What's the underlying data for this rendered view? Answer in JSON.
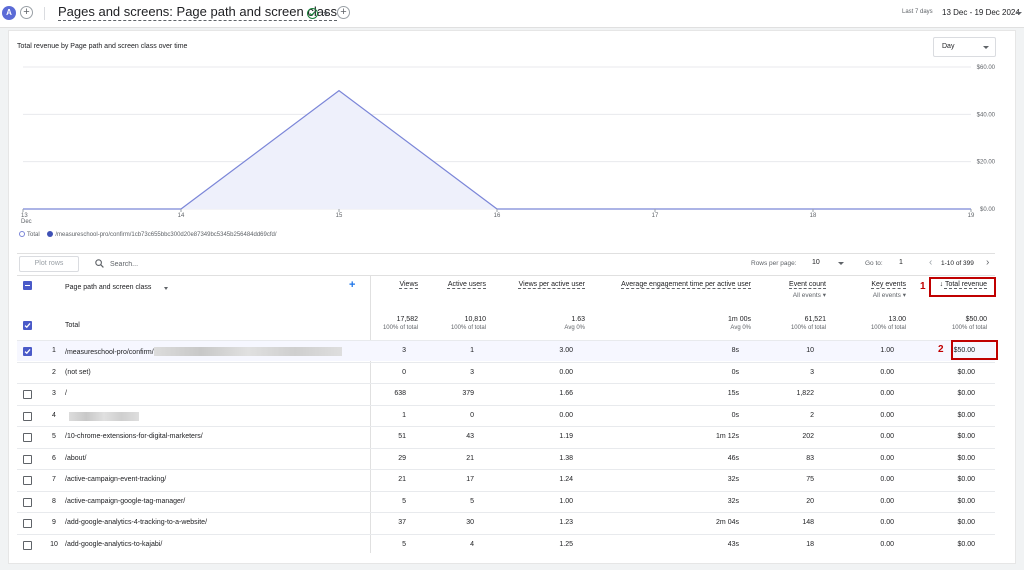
{
  "header": {
    "avatar_letter": "A",
    "title": "Pages and screens: Page path and screen class",
    "date_label": "Last 7 days",
    "date_range": "13 Dec - 19 Dec 2024"
  },
  "chart_card": {
    "title": "Total revenue by Page path and screen class over time",
    "granularity": "Day"
  },
  "chart_data": {
    "type": "area",
    "x": [
      "13 Dec",
      "14",
      "15",
      "16",
      "17",
      "18",
      "19"
    ],
    "x_ticks": [
      {
        "line1": "13",
        "line2": "Dec"
      },
      {
        "line1": "14",
        "line2": ""
      },
      {
        "line1": "15",
        "line2": ""
      },
      {
        "line1": "16",
        "line2": ""
      },
      {
        "line1": "17",
        "line2": ""
      },
      {
        "line1": "18",
        "line2": ""
      },
      {
        "line1": "19",
        "line2": ""
      }
    ],
    "y_ticks": [
      "$0.00",
      "$20.00",
      "$40.00",
      "$60.00"
    ],
    "ylim": [
      0,
      60
    ],
    "series": [
      {
        "name": "Total",
        "values": [
          0,
          0,
          50,
          0,
          0,
          0,
          0
        ],
        "color": "#7b86d8"
      },
      {
        "name": "/measureschool-pro/confirm/1cb73c655bbc300d20e87349bc5345b256484dd69cfd/",
        "values": [
          0,
          0,
          50,
          0,
          0,
          0,
          0
        ],
        "color": "#3f51b5"
      }
    ],
    "grid": true,
    "legend_position": "bottom-left"
  },
  "legend": {
    "total": "Total",
    "page": "/measureschool-pro/confirm/1cb73c655bbc300d20e87349bc5345b256484dd69cfd/"
  },
  "toolbar": {
    "plot_rows": "Plot rows",
    "search_placeholder": "Search...",
    "rows_per_page_label": "Rows per page:",
    "rows_per_page": "10",
    "goto_label": "Go to:",
    "goto_value": "1",
    "pager": "1-10 of 399"
  },
  "table": {
    "dimension_header": "Page path and screen class",
    "columns": [
      {
        "label": "Views",
        "sub": ""
      },
      {
        "label": "Active users",
        "sub": ""
      },
      {
        "label": "Views per active user",
        "sub": ""
      },
      {
        "label": "Average engagement time per active user",
        "sub": ""
      },
      {
        "label": "Event count",
        "sub": "All events"
      },
      {
        "label": "Key events",
        "sub": "All events"
      },
      {
        "label": "Total revenue",
        "sub": ""
      }
    ],
    "total": {
      "label": "Total",
      "values": [
        "17,582",
        "10,810",
        "1.63",
        "1m 00s",
        "61,521",
        "13.00",
        "$50.00"
      ],
      "subs": [
        "100% of total",
        "100% of total",
        "Avg 0%",
        "Avg 0%",
        "100% of total",
        "100% of total",
        "100% of total"
      ]
    },
    "rows": [
      {
        "rank": "1",
        "path": "/measureschool-pro/confirm/",
        "values": [
          "3",
          "1",
          "3.00",
          "8s",
          "10",
          "1.00",
          "$50.00"
        ]
      },
      {
        "rank": "2",
        "path": "(not set)",
        "values": [
          "0",
          "3",
          "0.00",
          "0s",
          "3",
          "0.00",
          "$0.00"
        ]
      },
      {
        "rank": "3",
        "path": "/",
        "values": [
          "638",
          "379",
          "1.66",
          "15s",
          "1,822",
          "0.00",
          "$0.00"
        ]
      },
      {
        "rank": "4",
        "path": "",
        "values": [
          "1",
          "0",
          "0.00",
          "0s",
          "2",
          "0.00",
          "$0.00"
        ]
      },
      {
        "rank": "5",
        "path": "/10-chrome-extensions-for-digital-marketers/",
        "values": [
          "51",
          "43",
          "1.19",
          "1m 12s",
          "202",
          "0.00",
          "$0.00"
        ]
      },
      {
        "rank": "6",
        "path": "/about/",
        "values": [
          "29",
          "21",
          "1.38",
          "46s",
          "83",
          "0.00",
          "$0.00"
        ]
      },
      {
        "rank": "7",
        "path": "/active-campaign-event-tracking/",
        "values": [
          "21",
          "17",
          "1.24",
          "32s",
          "75",
          "0.00",
          "$0.00"
        ]
      },
      {
        "rank": "8",
        "path": "/active-campaign-google-tag-manager/",
        "values": [
          "5",
          "5",
          "1.00",
          "32s",
          "20",
          "0.00",
          "$0.00"
        ]
      },
      {
        "rank": "9",
        "path": "/add-google-analytics-4-tracking-to-a-website/",
        "values": [
          "37",
          "30",
          "1.23",
          "2m 04s",
          "148",
          "0.00",
          "$0.00"
        ]
      },
      {
        "rank": "10",
        "path": "/add-google-analytics-to-kajabi/",
        "values": [
          "5",
          "4",
          "1.25",
          "43s",
          "18",
          "0.00",
          "$0.00"
        ]
      }
    ]
  },
  "annotations": {
    "one": "1",
    "two": "2"
  },
  "colors": {
    "accent": "#4a5ac8",
    "annotation": "#c00000",
    "chart_fill": "#eef0fb"
  }
}
